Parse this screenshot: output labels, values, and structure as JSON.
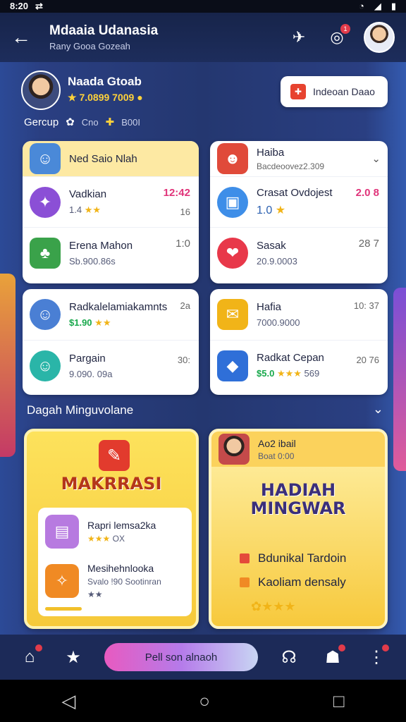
{
  "status": {
    "time": "8:20",
    "icon_left": "sync-icon",
    "icons_right": [
      "wifi-icon",
      "signal-icon",
      "battery-icon"
    ]
  },
  "appbar": {
    "title": "Mdaaia Udanasia",
    "subtitle": "Rany Gooa Gozeah",
    "icons": [
      "back-icon",
      "share-icon",
      "notification-icon",
      "avatar"
    ],
    "badge": "1"
  },
  "profile": {
    "name": "Naada Gtoab",
    "sub": "7.0899 7009",
    "invite_label": "Indeoan Daao",
    "group_label": "Gercup",
    "group_a": "Cno",
    "group_b": "B00I"
  },
  "card_tl": {
    "header": "Ned Saio Nlah",
    "rows": [
      {
        "name": "Vadkian",
        "meta": "1.4",
        "val": "12:42",
        "meta2": "16"
      },
      {
        "name": "Erena Mahon",
        "meta": "Sb.900.86s",
        "val": "1:0",
        "meta2": ""
      }
    ]
  },
  "card_tr": {
    "header": "Haiba",
    "header_sub": "Bacdeoovez2.309",
    "rows": [
      {
        "name": "Crasat Ovdojest",
        "meta": "1.0",
        "val": "2.0 8"
      },
      {
        "name": "Sasak",
        "meta": "20.9.0003",
        "val": "28 7"
      }
    ]
  },
  "card_ml": {
    "rows": [
      {
        "name": "Radkalelamiakamnts",
        "price": "$1.90",
        "meta": "2a",
        "val": "2a"
      },
      {
        "name": "Pargain",
        "meta": "9.090. 09a",
        "val": "30:"
      }
    ]
  },
  "card_mr": {
    "rows": [
      {
        "name": "Hafia",
        "meta": "7000.9000",
        "val": "10: 37"
      },
      {
        "name": "Radkat Cepan",
        "price": "$5.0",
        "meta": "569",
        "val": "20 76"
      }
    ]
  },
  "section": {
    "title": "Dagah Minguvolane"
  },
  "promo_left": {
    "banner": "MAKRRASI",
    "row1_name": "Rapri lemsa2ka",
    "row1_meta": "OX",
    "row2_name": "Mesihehnlooka",
    "row2_meta": "Svalo !90 Sootinran"
  },
  "promo_right": {
    "head_name": "Ao2 ibail",
    "head_meta": "Boat 0:00",
    "banner_line1": "HADIAH",
    "banner_line2": "MINGWAR",
    "bullet1": "Bdunikal Tardoin",
    "bullet2": "Kaoliam densaly"
  },
  "navbar": {
    "cta": "Pell son alnaoh"
  },
  "colors": {
    "accent": "#e0347a",
    "brand": "#1c2a55",
    "price": "#17a84b",
    "promo": "#f6c93a"
  }
}
